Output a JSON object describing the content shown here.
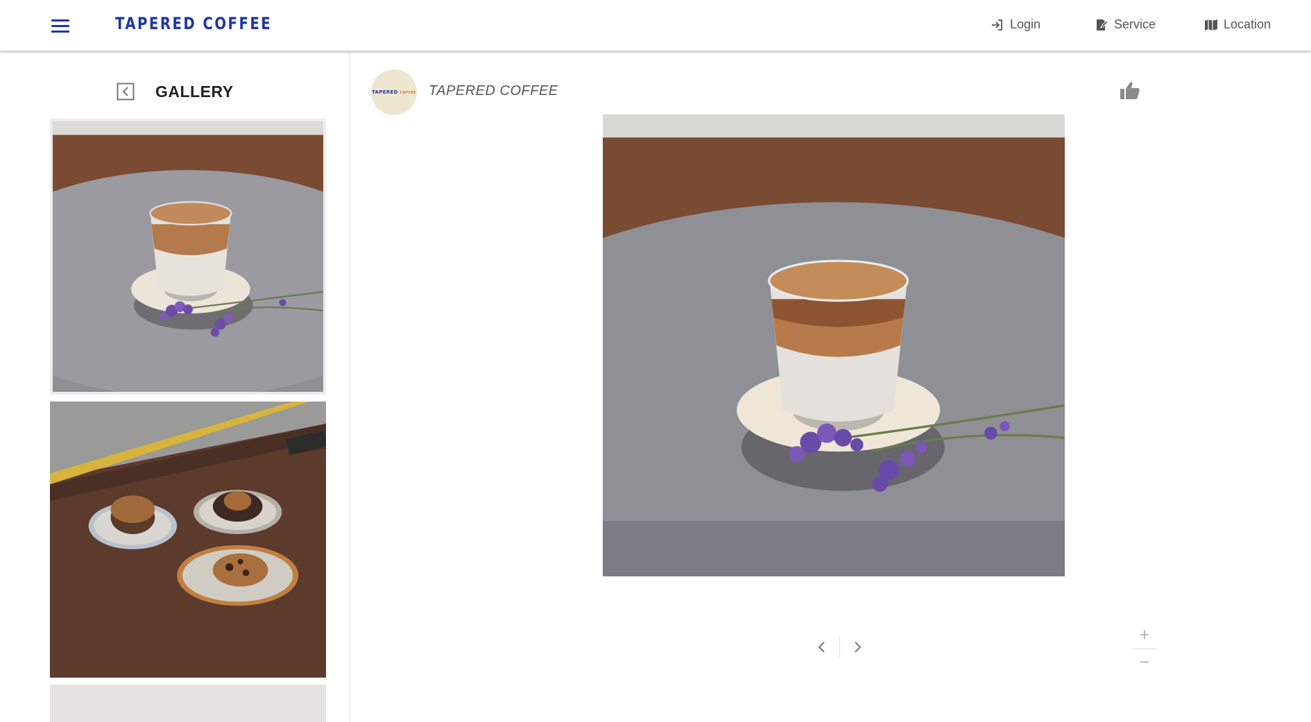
{
  "header": {
    "brand": "TAPERED COFFEE",
    "menu_icon": "hamburger-menu-icon",
    "nav": [
      {
        "label": "Login",
        "icon": "login-icon"
      },
      {
        "label": "Service",
        "icon": "edit-document-icon"
      },
      {
        "label": "Location",
        "icon": "map-icon"
      }
    ],
    "brand_color": "#1f35a8"
  },
  "sidebar": {
    "title": "GALLERY",
    "back_icon": "chevron-left-square-icon",
    "thumbnails": [
      {
        "subject": "iced latte on saucer with lavender"
      },
      {
        "subject": "three cookies on plates on wooden bench"
      },
      {
        "subject": "white wall"
      }
    ]
  },
  "post": {
    "author": "TAPERED COFFEE",
    "avatar_text": "TAPERED",
    "avatar_subtext": "COFFEE",
    "like_icon": "thumbs-up-icon",
    "pager": {
      "prev_icon": "chevron-left-icon",
      "next_icon": "chevron-right-icon"
    },
    "zoom": {
      "in_label": "+",
      "out_label": "−"
    }
  }
}
